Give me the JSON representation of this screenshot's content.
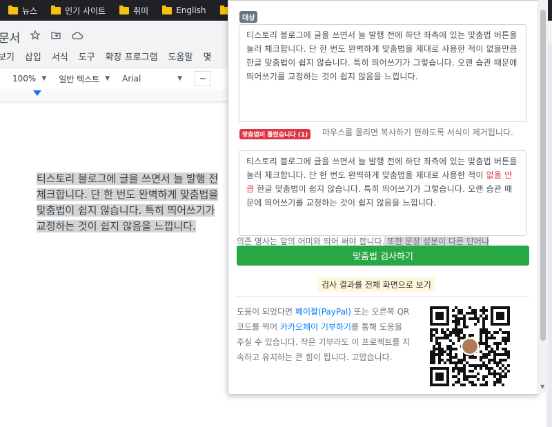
{
  "bookmarks": [
    {
      "label": "뉴스"
    },
    {
      "label": "인기 사이트"
    },
    {
      "label": "취미"
    },
    {
      "label": "English"
    }
  ],
  "docs": {
    "title": "문서",
    "menu": [
      "보기",
      "삽입",
      "서식",
      "도구",
      "확장 프로그램",
      "도움말",
      "몇"
    ],
    "zoom": "100%",
    "style": "일반 텍스트",
    "font": "Arial",
    "font_minus": "−",
    "body_lines": [
      "티스토리 블로그에 글을 쓰면서 늘 발행 전",
      "체크합니다. 단 한 번도 완벽하게 맞춤법을",
      "맞춤법이 쉽지 않습니다. 특히 띄어쓰기가",
      "교정하는 것이 쉽지 않음을 느낍니다."
    ]
  },
  "popup": {
    "target_badge": "대상",
    "target_text": "티스토리 블로그에 글을 쓰면서 늘 발행 전에 하단 좌측에 있는 맞춤법 버튼을 눌러 체크합니다. 단 한 번도 완벽하게 맞춤법을 제대로 사용한 적이 없을만큼 한글 맞춤법이 쉽지 않습니다. 특히 띄어쓰기가 그렇습니다. 오랜 습관 때문에 띄어쓰기를 교정하는 것이 쉽지 않음을 느낍니다.",
    "error_badge": "맞춤법이 틀렸습니다 (1)",
    "hint": "마우스를 올리면 복사하기 편하도록 서식이 제거됩니다.",
    "result_before": "티스토리 블로그에 글을 쓰면서 늘 발행 전에 하단 좌측에 있는 맞춤법 버튼을 눌러 체크합니다. 단 한 번도 완벽하게 맞춤법을 제대로 사용한 적이 ",
    "result_error": "없을 만큼",
    "result_after": " 한글 맞춤법이 쉽지 않습니다. 특히 띄어쓰기가 그렇습니다. 오랜 습관 때문에 띄어쓰기를 교정하는 것이 쉽지 않음을 느낍니다.",
    "note_plain": "의존 명사는 앞의 어미와 띄어 써야 합니다.",
    "note_highlight": " 또한 문장 성분이 다른 단어나",
    "check_button": "맞춤법 검사하기",
    "fullscreen_link": "검사 결과를 전체 화면으로 보기",
    "donate_1": "도움이 되었다면 ",
    "donate_paypal": "페이팔(PayPal)",
    "donate_2": " 또는 오른쪽 QR코드를 찍어 ",
    "donate_kakao": "카카오페이 기부하기",
    "donate_3": "를 통해 도움을 주실 수 있습니다. 작은 기부라도 이 프로젝트를 지속하고 유지하는 큰 힘이 됩니다. 고맙습니다."
  },
  "colors": {
    "accent_green": "#28a745",
    "error_red": "#dc3545",
    "link_blue": "#007bff",
    "badge_grey": "#6c757d"
  },
  "icons": [
    "folder-icon",
    "star-icon",
    "move-to-folder-icon",
    "cloud-icon",
    "qr-code-icon"
  ]
}
